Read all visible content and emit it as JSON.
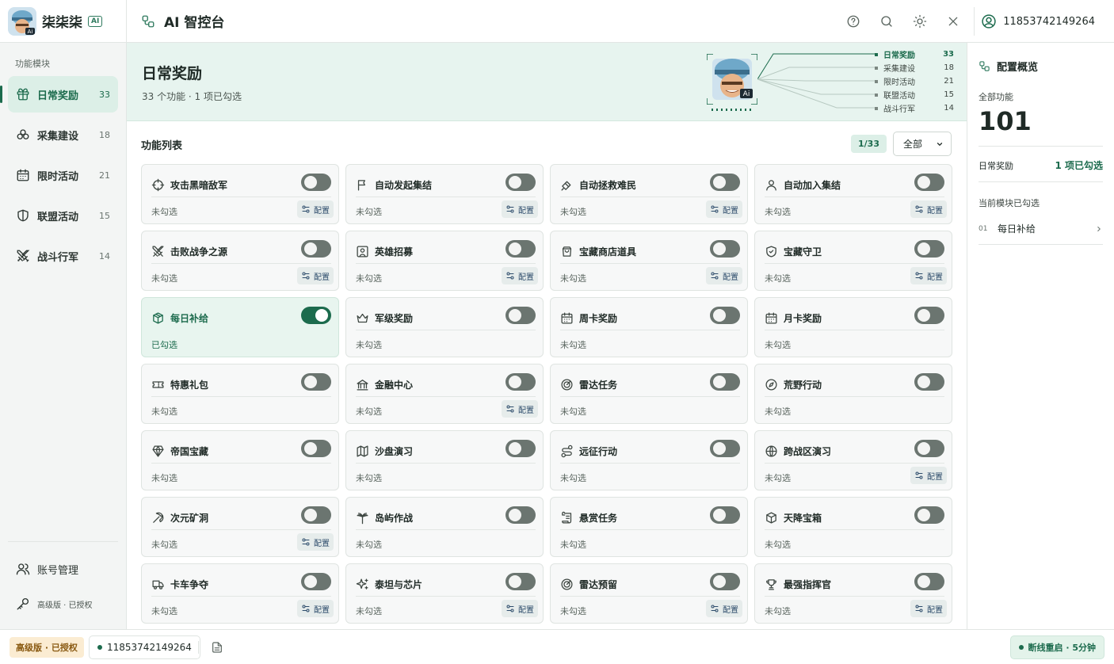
{
  "brand": {
    "name": "柒柒柒",
    "ai_badge": "AI"
  },
  "header": {
    "title": "AI 智控台",
    "user_id": "11853742149264"
  },
  "sidebar": {
    "section_label": "功能模块",
    "items": [
      {
        "label": "日常奖励",
        "count": "33",
        "icon": "gift-icon",
        "active": true
      },
      {
        "label": "采集建设",
        "count": "18",
        "icon": "resources-icon",
        "active": false
      },
      {
        "label": "限时活动",
        "count": "21",
        "icon": "calendar-icon",
        "active": false
      },
      {
        "label": "联盟活动",
        "count": "15",
        "icon": "shield-icon",
        "active": false
      },
      {
        "label": "战斗行军",
        "count": "14",
        "icon": "swords-icon",
        "active": false
      }
    ],
    "account_label": "账号管理",
    "license_label": "高级版 · 已授权"
  },
  "banner": {
    "title": "日常奖励",
    "subtitle": "33 个功能 · 1 项已勾选",
    "mini_list": [
      {
        "name": "日常奖励",
        "count": "33",
        "on": true
      },
      {
        "name": "采集建设",
        "count": "18",
        "on": false
      },
      {
        "name": "限时活动",
        "count": "21",
        "on": false
      },
      {
        "name": "联盟活动",
        "count": "15",
        "on": false
      },
      {
        "name": "战斗行军",
        "count": "14",
        "on": false
      }
    ]
  },
  "list": {
    "heading": "功能列表",
    "pager": "1/33",
    "filter_value": "全部",
    "config_label": "配置",
    "cards": [
      {
        "name": "攻击黑暗敌军",
        "status": "未勾选",
        "on": false,
        "cfg": true,
        "icon": "crosshair-icon"
      },
      {
        "name": "自动发起集结",
        "status": "未勾选",
        "on": false,
        "cfg": true,
        "icon": "flag-icon"
      },
      {
        "name": "自动拯救难民",
        "status": "未勾选",
        "on": false,
        "cfg": true,
        "icon": "rescue-icon"
      },
      {
        "name": "自动加入集结",
        "status": "未勾选",
        "on": false,
        "cfg": true,
        "icon": "user-icon"
      },
      {
        "name": "击败战争之源",
        "status": "未勾选",
        "on": false,
        "cfg": true,
        "icon": "swords-icon"
      },
      {
        "name": "英雄招募",
        "status": "未勾选",
        "on": false,
        "cfg": true,
        "icon": "portrait-icon"
      },
      {
        "name": "宝藏商店道具",
        "status": "未勾选",
        "on": false,
        "cfg": true,
        "icon": "shopping-bag-icon"
      },
      {
        "name": "宝藏守卫",
        "status": "未勾选",
        "on": false,
        "cfg": true,
        "icon": "shield-check-icon"
      },
      {
        "name": "每日补给",
        "status": "已勾选",
        "on": true,
        "cfg": false,
        "icon": "box-icon"
      },
      {
        "name": "军级奖励",
        "status": "未勾选",
        "on": false,
        "cfg": false,
        "icon": "crown-icon"
      },
      {
        "name": "周卡奖励",
        "status": "未勾选",
        "on": false,
        "cfg": false,
        "icon": "calendar-icon"
      },
      {
        "name": "月卡奖励",
        "status": "未勾选",
        "on": false,
        "cfg": false,
        "icon": "calendar-icon"
      },
      {
        "name": "特惠礼包",
        "status": "未勾选",
        "on": false,
        "cfg": false,
        "icon": "ticket-icon"
      },
      {
        "name": "金融中心",
        "status": "未勾选",
        "on": false,
        "cfg": true,
        "icon": "bank-icon"
      },
      {
        "name": "雷达任务",
        "status": "未勾选",
        "on": false,
        "cfg": false,
        "icon": "radar-icon"
      },
      {
        "name": "荒野行动",
        "status": "未勾选",
        "on": false,
        "cfg": false,
        "icon": "compass-icon"
      },
      {
        "name": "帝国宝藏",
        "status": "未勾选",
        "on": false,
        "cfg": false,
        "icon": "gem-icon"
      },
      {
        "name": "沙盘演习",
        "status": "未勾选",
        "on": false,
        "cfg": false,
        "icon": "map-icon"
      },
      {
        "name": "远征行动",
        "status": "未勾选",
        "on": false,
        "cfg": false,
        "icon": "route-icon"
      },
      {
        "name": "跨战区演习",
        "status": "未勾选",
        "on": false,
        "cfg": true,
        "icon": "globe-icon"
      },
      {
        "name": "次元矿洞",
        "status": "未勾选",
        "on": false,
        "cfg": true,
        "icon": "pickaxe-icon"
      },
      {
        "name": "岛屿作战",
        "status": "未勾选",
        "on": false,
        "cfg": false,
        "icon": "palm-tree-icon"
      },
      {
        "name": "悬赏任务",
        "status": "未勾选",
        "on": false,
        "cfg": false,
        "icon": "scroll-icon"
      },
      {
        "name": "天降宝箱",
        "status": "未勾选",
        "on": false,
        "cfg": false,
        "icon": "package-icon"
      },
      {
        "name": "卡车争夺",
        "status": "未勾选",
        "on": false,
        "cfg": true,
        "icon": "truck-icon"
      },
      {
        "name": "泰坦与芯片",
        "status": "未勾选",
        "on": false,
        "cfg": true,
        "icon": "sparkles-icon"
      },
      {
        "name": "雷达预留",
        "status": "未勾选",
        "on": false,
        "cfg": true,
        "icon": "radar-icon"
      },
      {
        "name": "最强指挥官",
        "status": "未勾选",
        "on": false,
        "cfg": true,
        "icon": "trophy-icon"
      }
    ]
  },
  "overview": {
    "title": "配置概览",
    "total_label": "全部功能",
    "total_value": "101",
    "module_label": "日常奖励",
    "module_value": "1 项已勾选",
    "selected_label": "当前模块已勾选",
    "selected_items": [
      {
        "index": "01",
        "name": "每日补给"
      }
    ]
  },
  "footer": {
    "license": "高级版 · 已授权",
    "user_id": "11853742149264",
    "status": "断线重启 · 5分钟"
  },
  "colors": {
    "accent": "#1c6b4d",
    "accent_light": "#dcefe7",
    "banner_bg": "#e7f4ef",
    "toggle_off": "#6b7570",
    "gold_tag": "#fbecd2"
  }
}
